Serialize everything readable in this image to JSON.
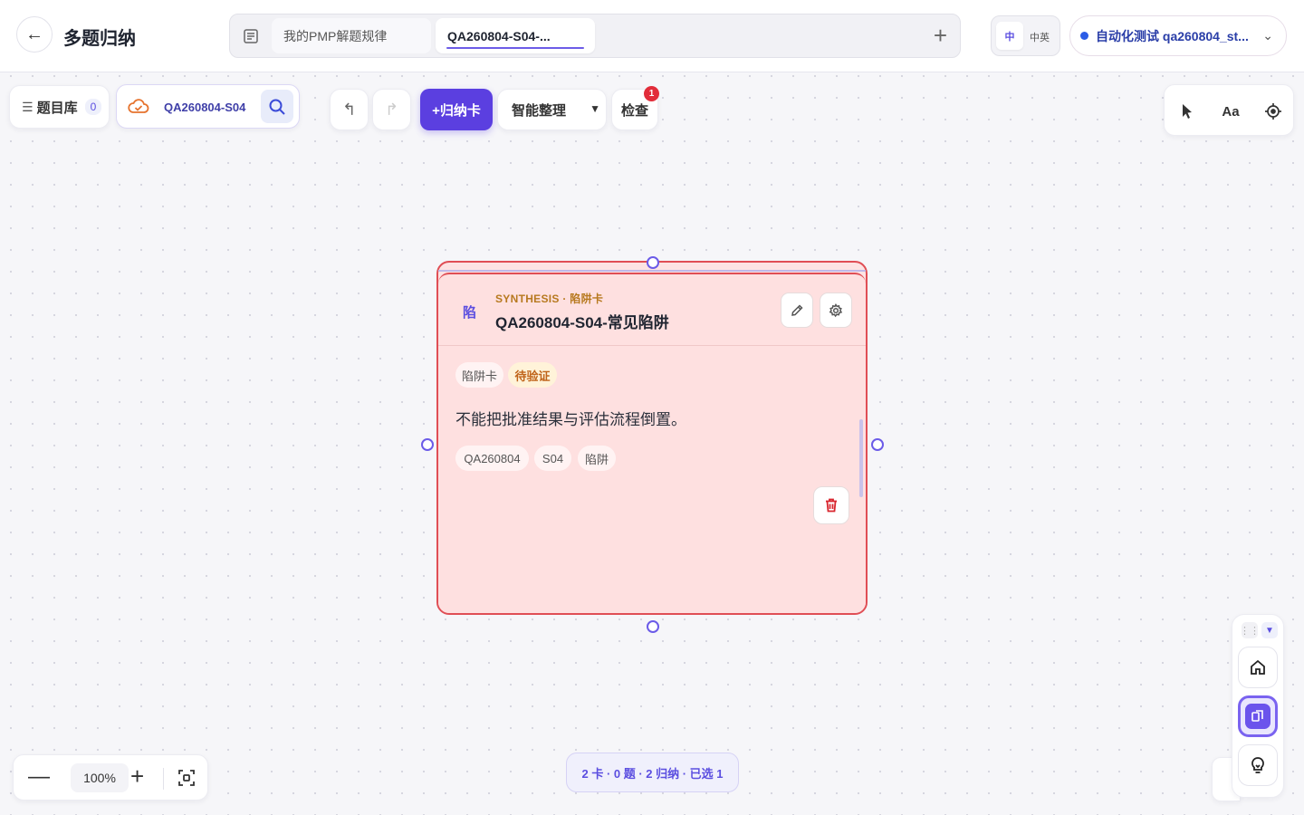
{
  "header": {
    "back_icon": "arrow-left-icon",
    "title": "多题归纳",
    "tabs": [
      {
        "label": "我的PMP解题规律",
        "active": false
      },
      {
        "label": "QA260804-S04-...",
        "active": true
      }
    ],
    "add_tab_icon": "plus-icon",
    "language": {
      "primary": "中",
      "bilingual": "中英"
    },
    "user": {
      "name": "自动化测试 qa260804_st...",
      "status_color": "#2b5ce6"
    }
  },
  "toolbar": {
    "library_label": "题目库",
    "library_count": "0",
    "search_value": "QA260804-S04",
    "add_card_label": "+归纳卡",
    "smart_organize_label": "智能整理",
    "check_label": "检查",
    "check_badge": "1",
    "accent_color": "#5b3fe0"
  },
  "tools": {
    "text_tool_label": "Aa"
  },
  "card": {
    "icon_letter": "陷",
    "subtitle": "SYNTHESIS · 陷阱卡",
    "title": "QA260804-S04-常见陷阱",
    "type_chip": "陷阱卡",
    "status_chip": "待验证",
    "body": "不能把批准结果与评估流程倒置。",
    "tags": [
      "QA260804",
      "S04",
      "陷阱"
    ],
    "border_color": "#e04e55",
    "background_color": "#fee0e0"
  },
  "zoom": {
    "value": "100%"
  },
  "status_bar": {
    "text": "2 卡 · 0 题 · 2 归纳 · 已选 1"
  }
}
